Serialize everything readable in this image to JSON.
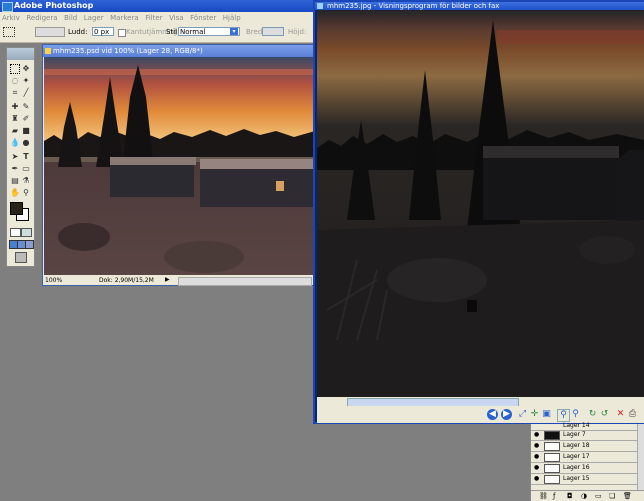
{
  "photoshop": {
    "title": "Adobe Photoshop",
    "menu": [
      "Arkiv",
      "Redigera",
      "Bild",
      "Lager",
      "Markera",
      "Filter",
      "Visa",
      "Fönster",
      "Hjälp"
    ],
    "options": {
      "feather_label": "Ludd:",
      "feather_value": "0 px",
      "antialias_label": "Kantutjämning",
      "style_label": "Stil:",
      "style_value": "Normal",
      "width_label": "Bredd:",
      "height_label": "Höjd:"
    }
  },
  "document": {
    "title": "mhm235.psd vid 100% (Lager 28, RGB/8*)",
    "zoom": "100%",
    "doc_size": "Dok: 2,90M/15,2M"
  },
  "viewer": {
    "title": "mhm235.jpg - Visningsprogram för bilder och fax"
  },
  "layers": {
    "items": [
      {
        "name": "Lager 14"
      },
      {
        "name": "Lager 7"
      },
      {
        "name": "Lager 18"
      },
      {
        "name": "Lager 17"
      },
      {
        "name": "Lager 16"
      },
      {
        "name": "Lager 15"
      }
    ]
  },
  "colors": {
    "titlebar": "#1848c2",
    "chrome": "#ece9d8",
    "desktop": "#7f7f7f"
  }
}
